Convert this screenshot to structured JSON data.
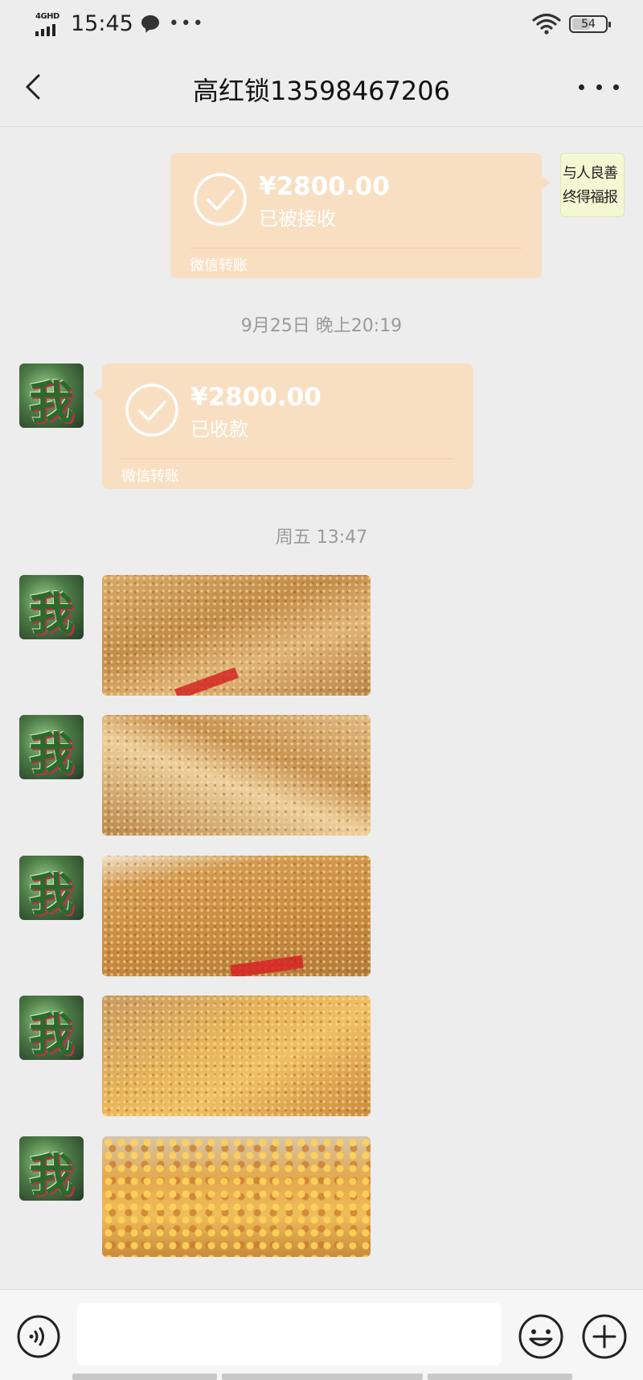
{
  "status_bar": {
    "network_label": "4GHD",
    "time": "15:45",
    "notification_icons": [
      "chat-bubble-icon",
      "more-dots-icon"
    ],
    "more_text": "•••",
    "battery_level": "54",
    "battery_fraction": 0.54
  },
  "header": {
    "title": "高红锁13598467206",
    "back_icon": "chevron-left-icon",
    "more_icon": "more-horizontal-icon"
  },
  "self_avatar": {
    "calligraphy_line1": "与人良善",
    "calligraphy_line2": "终得福报"
  },
  "other_avatar": {
    "glyph": "我"
  },
  "messages": [
    {
      "type": "transfer",
      "sender": "self",
      "amount": "¥2800.00",
      "status": "已被接收",
      "source": "微信转账"
    },
    {
      "type": "timestamp",
      "text": "9月25日 晚上20:19"
    },
    {
      "type": "transfer",
      "sender": "other",
      "amount": "¥2800.00",
      "status": "已收款",
      "source": "微信转账"
    },
    {
      "type": "timestamp",
      "text": "周五 13:47"
    },
    {
      "type": "image",
      "sender": "other",
      "alt": "corn-sacks-photo"
    },
    {
      "type": "image",
      "sender": "other",
      "alt": "corn-sacks-photo"
    },
    {
      "type": "image",
      "sender": "other",
      "alt": "corn-sacks-photo"
    },
    {
      "type": "image",
      "sender": "other",
      "alt": "corn-sacks-photo"
    },
    {
      "type": "image",
      "sender": "other",
      "alt": "corn-kernels-photo"
    }
  ],
  "input_bar": {
    "voice_icon": "voice-icon",
    "input_value": "",
    "emoji_icon": "emoji-icon",
    "plus_icon": "plus-circle-icon"
  },
  "colors": {
    "background": "#ededed",
    "transfer_bubble": "#f9dfc2",
    "timestamp_text": "#9a9a9a",
    "input_bar_bg": "#f6f6f6"
  }
}
